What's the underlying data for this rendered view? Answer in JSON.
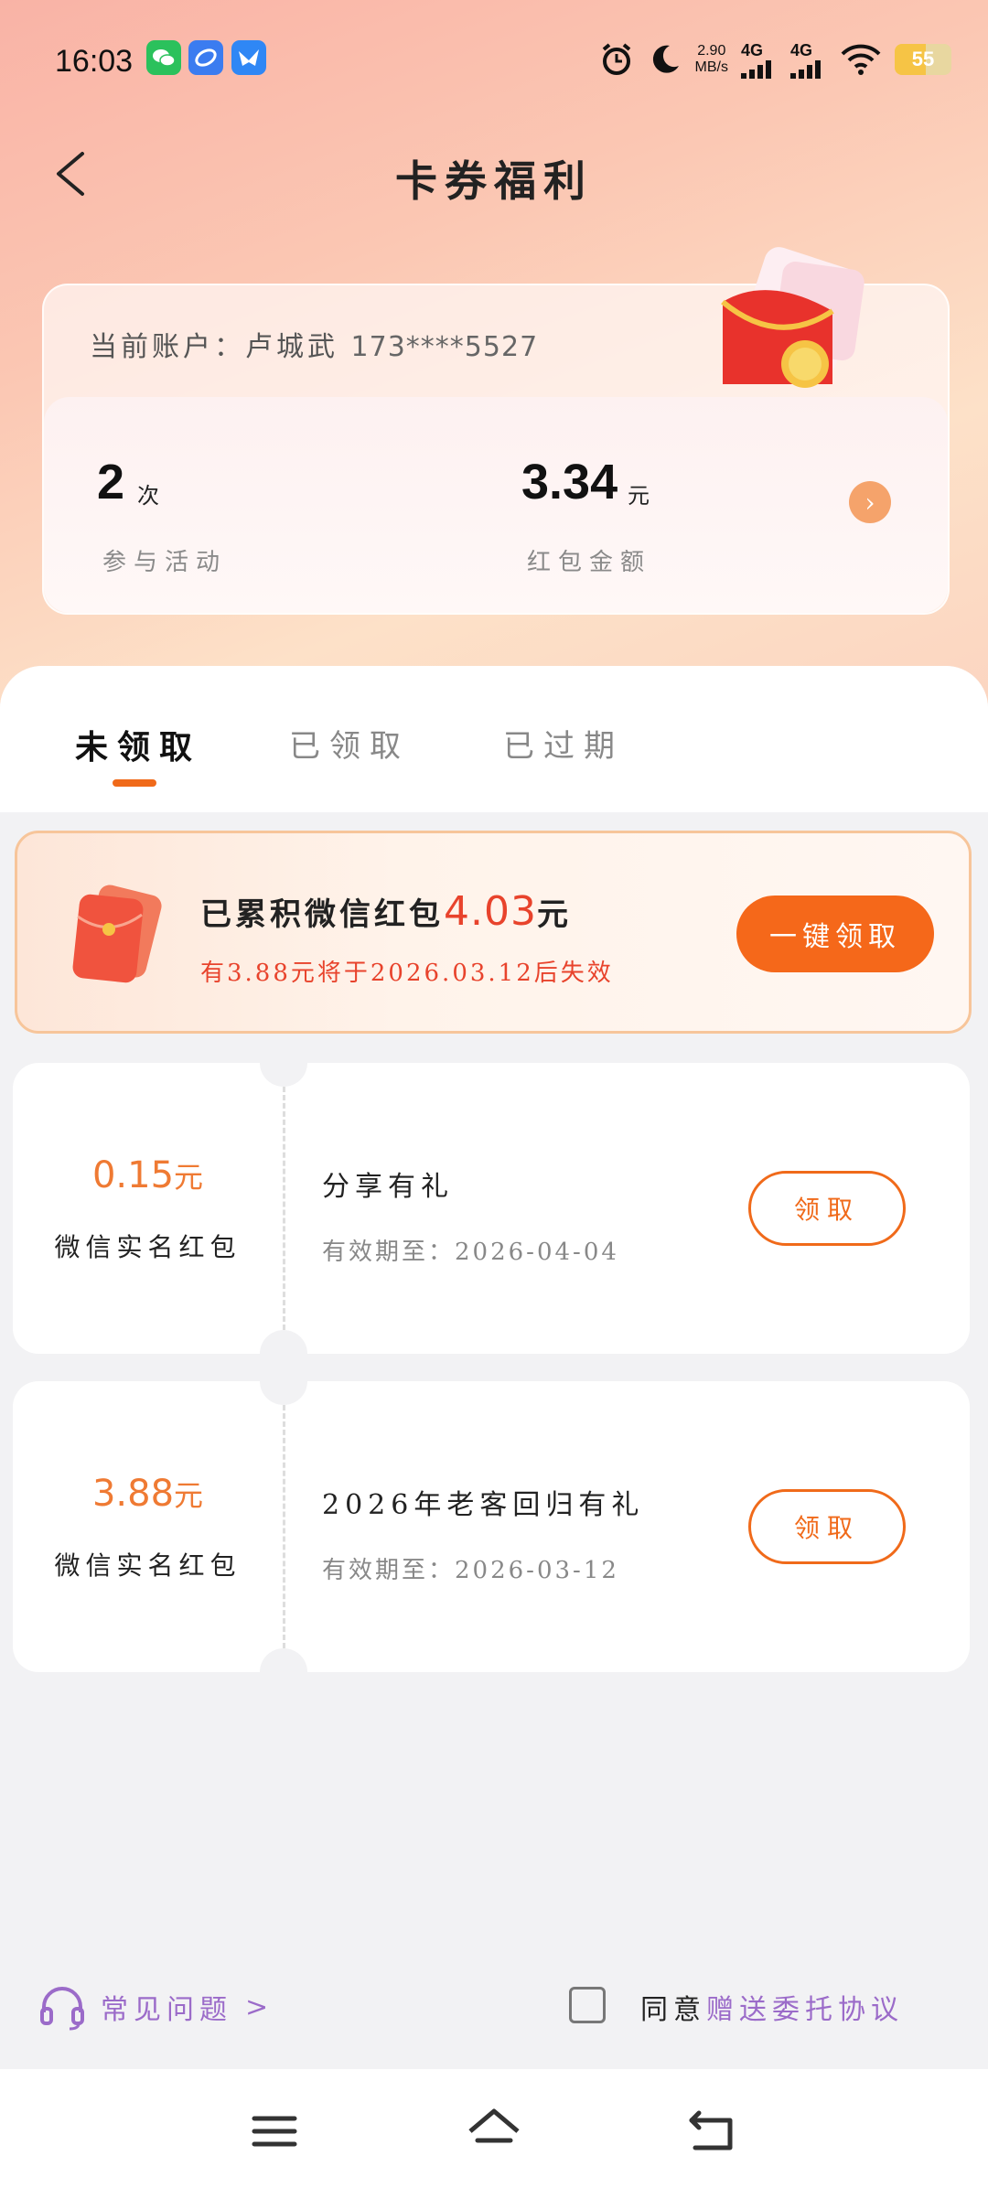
{
  "status_bar": {
    "time": "16:03",
    "net_speed_value": "2.90",
    "net_speed_unit": "MB/s",
    "signal1": "4G",
    "signal2": "4G",
    "battery": "55"
  },
  "header": {
    "title": "卡券福利"
  },
  "account": {
    "label": "当前账户：卢城武",
    "phone": "173****5527"
  },
  "stats": {
    "activity_count": "2",
    "activity_unit": "次",
    "activity_label": "参与活动",
    "amount": "3.34",
    "amount_unit": "元",
    "amount_label": "红包金额"
  },
  "tabs": [
    {
      "label": "未领取"
    },
    {
      "label": "已领取"
    },
    {
      "label": "已过期"
    }
  ],
  "summary": {
    "prefix": "已累积微信红包",
    "amount": "4.03",
    "unit": "元",
    "expiry_note": "有3.88元将于2026.03.12后失效",
    "claim_all_label": "一键领取"
  },
  "coupons": [
    {
      "amount": "0.15",
      "unit": "元",
      "type": "微信实名红包",
      "title": "分享有礼",
      "expiry": "有效期至：2026-04-04",
      "button": "领取"
    },
    {
      "amount": "3.88",
      "unit": "元",
      "type": "微信实名红包",
      "title": "2026年老客回归有礼",
      "expiry": "有效期至：2026-03-12",
      "button": "领取"
    }
  ],
  "footer": {
    "faq_label": "常见问题",
    "agree_prefix": "同意",
    "agree_link": "赠送委托协议"
  },
  "colors": {
    "accent": "#f06a1a",
    "amount_red": "#e8432c",
    "link_purple": "#9b6bc9"
  }
}
